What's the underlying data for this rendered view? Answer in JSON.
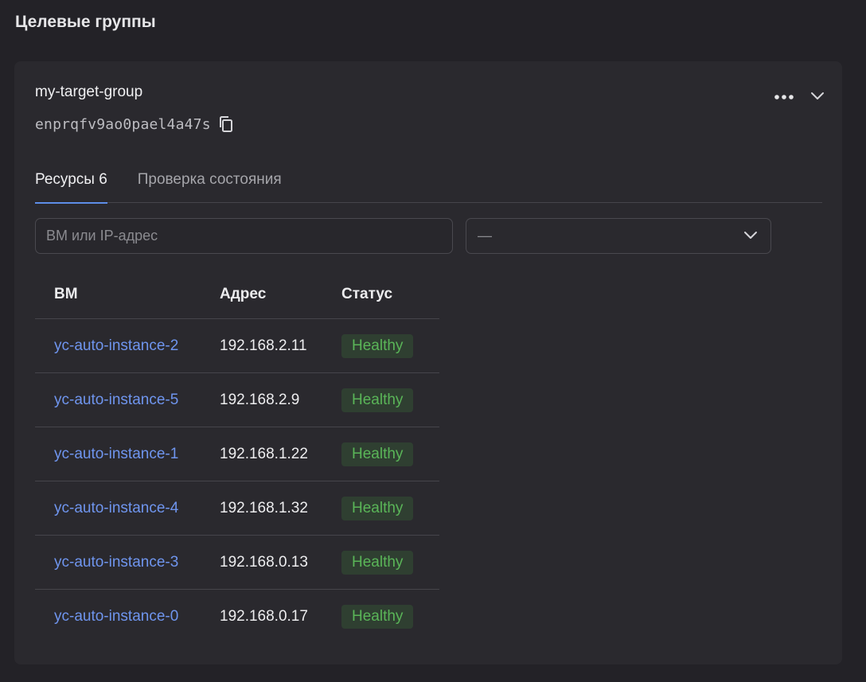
{
  "page": {
    "title": "Целевые группы"
  },
  "group": {
    "name": "my-target-group",
    "id": "enprqfv9ao0pael4a47s"
  },
  "icons": {
    "copy": "copy-icon",
    "more": "more-dots-icon",
    "expand": "chevron-down-icon",
    "select_arrow": "chevron-down-icon"
  },
  "tabs": [
    {
      "label": "Ресурсы 6",
      "active": true
    },
    {
      "label": "Проверка состояния",
      "active": false
    }
  ],
  "filters": {
    "search_placeholder": "ВМ или IP-адрес",
    "status_value": "—"
  },
  "table": {
    "headers": {
      "vm": "ВМ",
      "address": "Адрес",
      "status": "Статус"
    },
    "rows": [
      {
        "vm": "yc-auto-instance-2",
        "address": "192.168.2.11",
        "status": "Healthy"
      },
      {
        "vm": "yc-auto-instance-5",
        "address": "192.168.2.9",
        "status": "Healthy"
      },
      {
        "vm": "yc-auto-instance-1",
        "address": "192.168.1.22",
        "status": "Healthy"
      },
      {
        "vm": "yc-auto-instance-4",
        "address": "192.168.1.32",
        "status": "Healthy"
      },
      {
        "vm": "yc-auto-instance-3",
        "address": "192.168.0.13",
        "status": "Healthy"
      },
      {
        "vm": "yc-auto-instance-0",
        "address": "192.168.0.17",
        "status": "Healthy"
      }
    ]
  },
  "colors": {
    "background": "#232227",
    "card": "#2a292e",
    "link": "#6f95ee",
    "tab_accent": "#5d8ee8",
    "healthy_text": "#5ab558",
    "healthy_bg": "#2f3f31"
  }
}
